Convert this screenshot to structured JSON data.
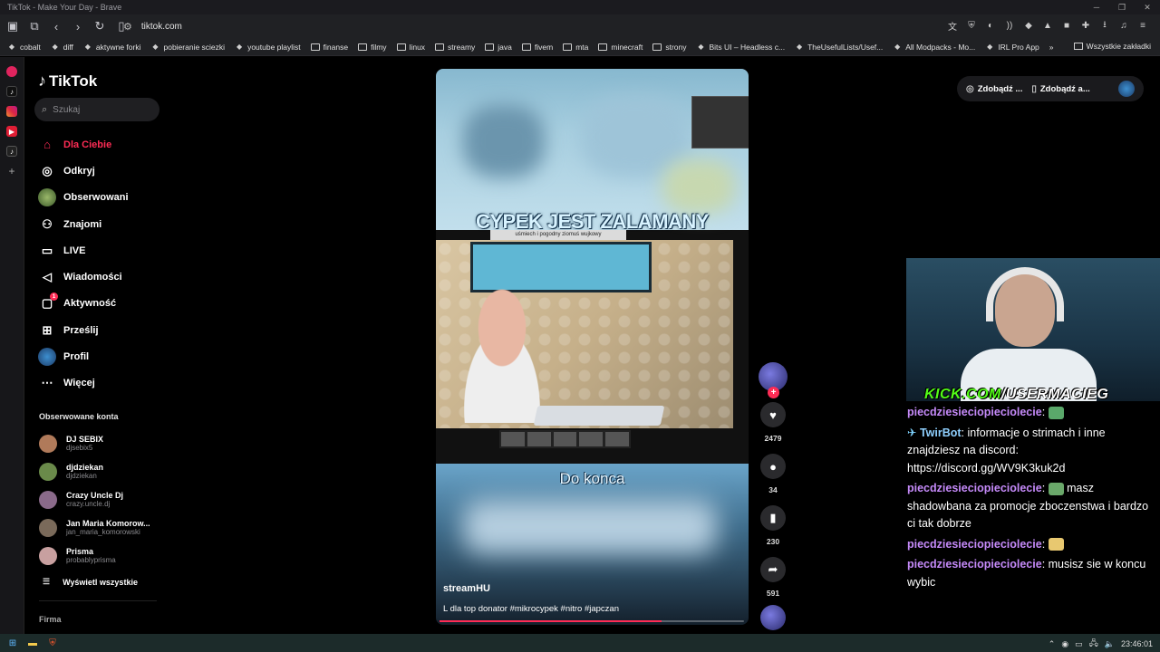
{
  "window": {
    "title": "TikTok - Make Your Day - Brave"
  },
  "browser": {
    "url": "tiktok.com",
    "bookmarks": [
      "cobalt",
      "diff",
      "aktywne forki",
      "pobieranie sciezki",
      "youtube playlist",
      "finanse",
      "filmy",
      "linux",
      "streamy",
      "java",
      "fivem",
      "mta",
      "minecraft",
      "strony",
      "Bits UI – Headless c...",
      "TheUsefulLists/Usef...",
      "All Modpacks - Mo...",
      "IRL Pro App"
    ],
    "all_bookmarks": "Wszystkie zakładki"
  },
  "tiktok": {
    "logo": "TikTok",
    "search_placeholder": "Szukaj",
    "nav": [
      {
        "label": "Dla Ciebie",
        "icon": "home-icon"
      },
      {
        "label": "Odkryj",
        "icon": "compass-icon"
      },
      {
        "label": "Obserwowani",
        "icon": "following-avatar-icon"
      },
      {
        "label": "Znajomi",
        "icon": "friends-icon"
      },
      {
        "label": "LIVE",
        "icon": "live-tv-icon"
      },
      {
        "label": "Wiadomości",
        "icon": "send-icon"
      },
      {
        "label": "Aktywność",
        "icon": "activity-icon",
        "badge": "1"
      },
      {
        "label": "Prześlij",
        "icon": "upload-icon"
      },
      {
        "label": "Profil",
        "icon": "profile-avatar-icon"
      },
      {
        "label": "Więcej",
        "icon": "more-icon"
      }
    ],
    "following_title": "Obserwowane konta",
    "accounts": [
      {
        "name": "DJ SEBIX",
        "handle": "djsebix5",
        "color": "#b07a5a"
      },
      {
        "name": "djdziekan",
        "handle": "djdziekan",
        "color": "#6a8a4a"
      },
      {
        "name": "Crazy Uncle Dj",
        "handle": "crazy.uncle.dj",
        "color": "#8a6a8a"
      },
      {
        "name": "Jan Maria Komorow...",
        "handle": "jan_maria_komorowski",
        "color": "#7a6a5a"
      },
      {
        "name": "Prisma",
        "handle": "probablyprisma",
        "color": "#c8a0a0"
      }
    ],
    "show_all": "Wyświetl wszystkie",
    "footer_section": "Firma",
    "top_right": {
      "coins": "Zdobądź ...",
      "app": "Zdobądź a..."
    }
  },
  "video": {
    "title_overlay": "CYPEK JEST ZALAMANY",
    "sub_overlay": "uśmiech i pogodny ziomuś wujkowy",
    "caption_overlay": "Do konca",
    "author": "streamHU",
    "description": "L dla top donator #mikrocypek #nitro #japczan",
    "progress": 0.73,
    "stats": {
      "likes": "2479",
      "comments": "34",
      "saves": "230",
      "shares": "591"
    }
  },
  "stream_overlay": {
    "watermark_prefix": "KICK.COM",
    "watermark_suffix": "/USERMACIEG",
    "chat": [
      {
        "user": "piecdziesieciopieciolecie",
        "text": ":",
        "emote": "#5aa86a",
        "type": "user"
      },
      {
        "user": "TwirBot",
        "text": ": informacje o strimach i inne znajdziesz na discord: https://discord.gg/WV9K3kuk2d",
        "type": "bot"
      },
      {
        "user": "piecdziesieciopieciolecie",
        "text": "masz shadowbana za promocje zboczenstwa i bardzo ci tak dobrze",
        "emote": "#6aa86a",
        "type": "user",
        "emote_before_text": true
      },
      {
        "user": "piecdziesieciopieciolecie",
        "text": ":",
        "emote": "#e8c870",
        "type": "user"
      },
      {
        "user": "piecdziesieciopieciolecie",
        "text": ": musisz sie w koncu wybic",
        "type": "user"
      }
    ]
  },
  "taskbar": {
    "clock": "23:46:01"
  },
  "colors": {
    "accent": "#fe2c55",
    "chat_user": "#c58af9",
    "kick_green": "#53fc18"
  }
}
